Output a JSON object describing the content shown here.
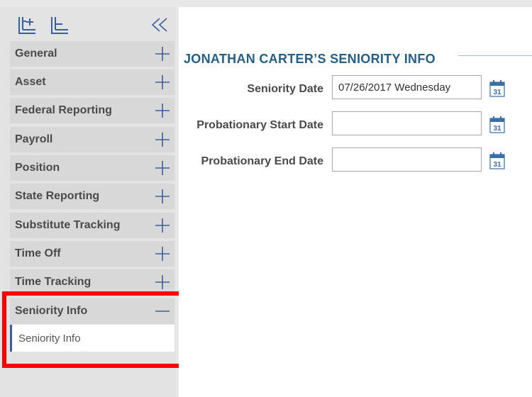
{
  "sidebar": {
    "toolbar": {
      "expand_all_icon": "expand-all-icon",
      "collapse_all_icon": "collapse-all-icon",
      "collapse_sidebar_icon": "double-chevron-left-icon"
    },
    "items": [
      {
        "label": "General",
        "state": "collapsed"
      },
      {
        "label": "Asset",
        "state": "collapsed"
      },
      {
        "label": "Federal Reporting",
        "state": "collapsed"
      },
      {
        "label": "Payroll",
        "state": "collapsed"
      },
      {
        "label": "Position",
        "state": "collapsed"
      },
      {
        "label": "State Reporting",
        "state": "collapsed"
      },
      {
        "label": "Substitute Tracking",
        "state": "collapsed"
      },
      {
        "label": "Time Off",
        "state": "collapsed"
      },
      {
        "label": "Time Tracking",
        "state": "collapsed"
      },
      {
        "label": "Seniority Info",
        "state": "expanded",
        "children": [
          "Seniority Info"
        ]
      }
    ]
  },
  "main": {
    "title": "JONATHAN CARTER’S SENIORITY INFO",
    "fields": [
      {
        "label": "Seniority Date",
        "value": "07/26/2017 Wednesday"
      },
      {
        "label": "Probationary Start Date",
        "value": ""
      },
      {
        "label": "Probationary End Date",
        "value": ""
      }
    ]
  },
  "colors": {
    "accent": "#3a5f9f",
    "title": "#245f8a",
    "highlight": "#ff0000"
  }
}
